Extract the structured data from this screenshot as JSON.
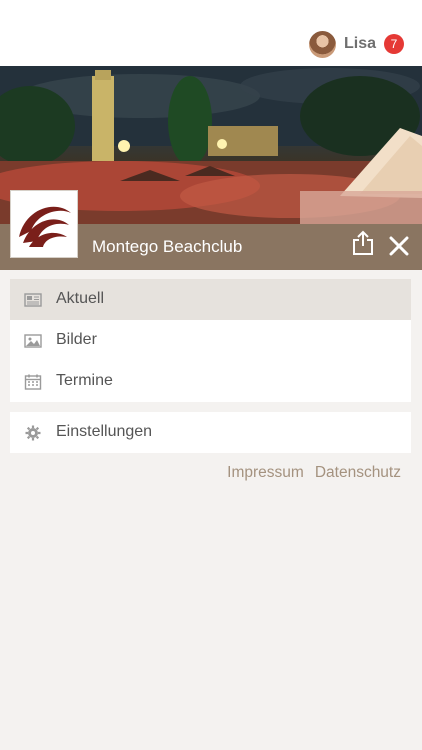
{
  "header": {
    "user_name": "Lisa",
    "notification_count": "7"
  },
  "club": {
    "name": "Montego Beachclub"
  },
  "menu": {
    "items": [
      {
        "label": "Aktuell",
        "icon": "newspaper-icon",
        "active": true
      },
      {
        "label": "Bilder",
        "icon": "image-icon",
        "active": false
      },
      {
        "label": "Termine",
        "icon": "calendar-icon",
        "active": false
      }
    ],
    "settings": {
      "label": "Einstellungen",
      "icon": "gear-icon"
    }
  },
  "footer": {
    "impressum": "Impressum",
    "datenschutz": "Datenschutz"
  },
  "colors": {
    "accent": "#8a7561",
    "badge": "#e53935",
    "link": "#a4927f",
    "active_row": "#e6e2dd"
  }
}
